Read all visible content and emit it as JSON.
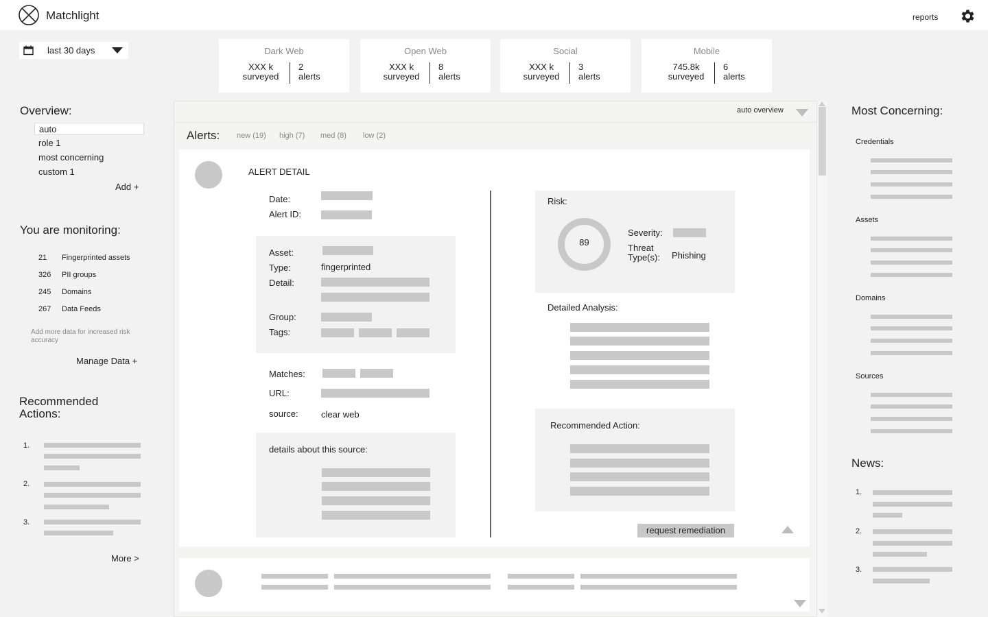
{
  "app": {
    "title": "Matchlight"
  },
  "header": {
    "reports_label": "reports"
  },
  "filter": {
    "date_range": "last 30 days"
  },
  "stats": [
    {
      "title": "Dark Web",
      "surveyed": "XXX k",
      "surveyed_label": "surveyed",
      "alerts": "2",
      "alerts_label": "alerts"
    },
    {
      "title": "Open Web",
      "surveyed": "XXX k",
      "surveyed_label": "surveyed",
      "alerts": "8",
      "alerts_label": "alerts"
    },
    {
      "title": "Social",
      "surveyed": "XXX k",
      "surveyed_label": "surveyed",
      "alerts": "3",
      "alerts_label": "alerts"
    },
    {
      "title": "Mobile",
      "surveyed": "745.8k",
      "surveyed_label": "surveyed",
      "alerts": "6",
      "alerts_label": "alerts"
    }
  ],
  "overview": {
    "title": "Overview:",
    "items": [
      "auto",
      "role 1",
      "most concerning",
      "custom 1"
    ],
    "add_label": "Add +"
  },
  "monitoring": {
    "title": "You are monitoring:",
    "items": [
      {
        "count": "21",
        "label": "Fingerprinted assets"
      },
      {
        "count": "326",
        "label": "PII groups"
      },
      {
        "count": "245",
        "label": "Domains"
      },
      {
        "count": "267",
        "label": "Data Feeds"
      }
    ],
    "note": "Add more data for increased risk accuracy",
    "manage_label": "Manage Data +"
  },
  "recommended": {
    "title": "Recommended Actions:",
    "numbers": [
      "1.",
      "2.",
      "3."
    ],
    "more_label": "More >"
  },
  "main": {
    "view_select": "auto overview",
    "alerts_title": "Alerts:",
    "tabs": [
      "new (19)",
      "high  (7)",
      "med  (8)",
      "low  (2)"
    ]
  },
  "alert_detail": {
    "heading": "ALERT DETAIL",
    "date_label": "Date:",
    "alert_id_label": "Alert ID:",
    "asset_label": "Asset:",
    "type_label": "Type:",
    "type_value": "fingerprinted",
    "detail_label": "Detail:",
    "group_label": "Group:",
    "tags_label": "Tags:",
    "matches_label": "Matches:",
    "url_label": "URL:",
    "source_label": "source:",
    "source_value": "clear web",
    "source_details_label": "details about this source:",
    "risk_label": "Risk:",
    "risk_score": "89",
    "severity_label": "Severity:",
    "threat_type_label": "Threat Type(s):",
    "threat_type_value": "Phishing",
    "analysis_label": "Detailed Analysis:",
    "rec_action_label": "Recommended Action:",
    "remediation_button": "request remediation"
  },
  "right": {
    "title": "Most Concerning:",
    "categories": [
      "Credentials",
      "Assets",
      "Domains",
      "Sources"
    ],
    "news_title": "News:",
    "news_numbers": [
      "1.",
      "2.",
      "3."
    ]
  },
  "icons": {
    "logo": "circle-x-logo-icon",
    "settings": "gear-icon",
    "calendar": "calendar-icon",
    "dropdown": "chevron-down-icon"
  }
}
